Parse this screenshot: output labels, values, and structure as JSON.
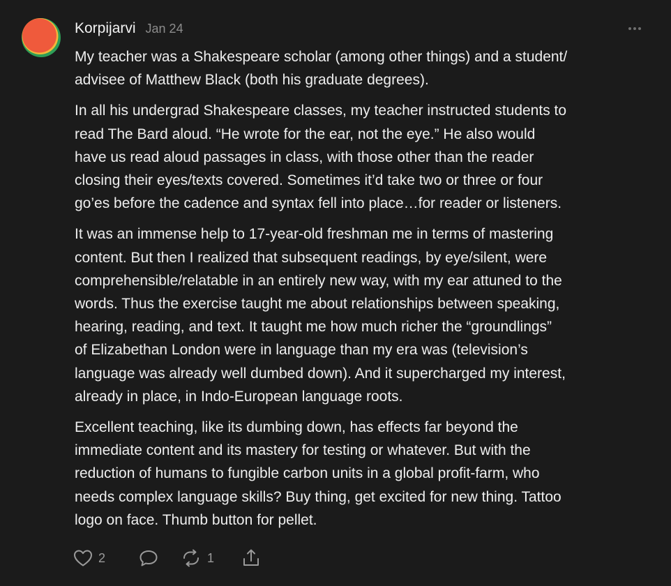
{
  "comment": {
    "author": "Korpijarvi",
    "date": "Jan 24",
    "paragraphs": [
      [
        "My teacher was a Shakespeare scholar (among other things) and a student/",
        "advisee of Matthew Black (both his graduate degrees)."
      ],
      [
        "In all his undergrad Shakespeare classes, my teacher instructed students to",
        "read The Bard aloud. “He wrote for the ear, not the eye.” He also would",
        "have us read aloud passages in class, with those other than the reader",
        "closing their eyes/texts covered. Sometimes it’d take two or three or four",
        "go’es before the cadence and syntax fell into place…for reader or listeners."
      ],
      [
        "It was an immense help to 17-year-old freshman me in terms of mastering",
        "content. But then I realized that subsequent readings, by eye/silent, were",
        "comprehensible/relatable in an entirely new way, with my ear attuned to the",
        "words. Thus the exercise taught me about relationships between speaking,",
        "hearing, reading, and text. It taught me how much richer the “groundlings”",
        "of Elizabethan London were in language than my era was (television’s",
        "language was already well dumbed down). And it supercharged my interest,",
        "already in place, in Indo-European language roots."
      ],
      [
        "Excellent teaching, like its dumbing down, has effects far beyond the",
        "immediate content and its mastery for testing or whatever. But with the",
        "reduction of humans to fungible carbon units in a global profit-farm, who",
        "needs complex language skills? Buy thing, get excited for new thing. Tattoo",
        "logo on face. Thumb button for pellet."
      ]
    ]
  },
  "actions": {
    "like_count": "2",
    "restack_count": "1"
  },
  "icons": {
    "like": "heart-icon",
    "reply": "speech-bubble-icon",
    "restack": "restack-arrows-icon",
    "share": "share-upload-icon",
    "more": "ellipsis-icon"
  },
  "colors": {
    "background": "#1b1b1b",
    "avatar_outer": "#2e9e57",
    "avatar_mid": "#f3b83a",
    "avatar_inner": "#ef5a3c"
  }
}
